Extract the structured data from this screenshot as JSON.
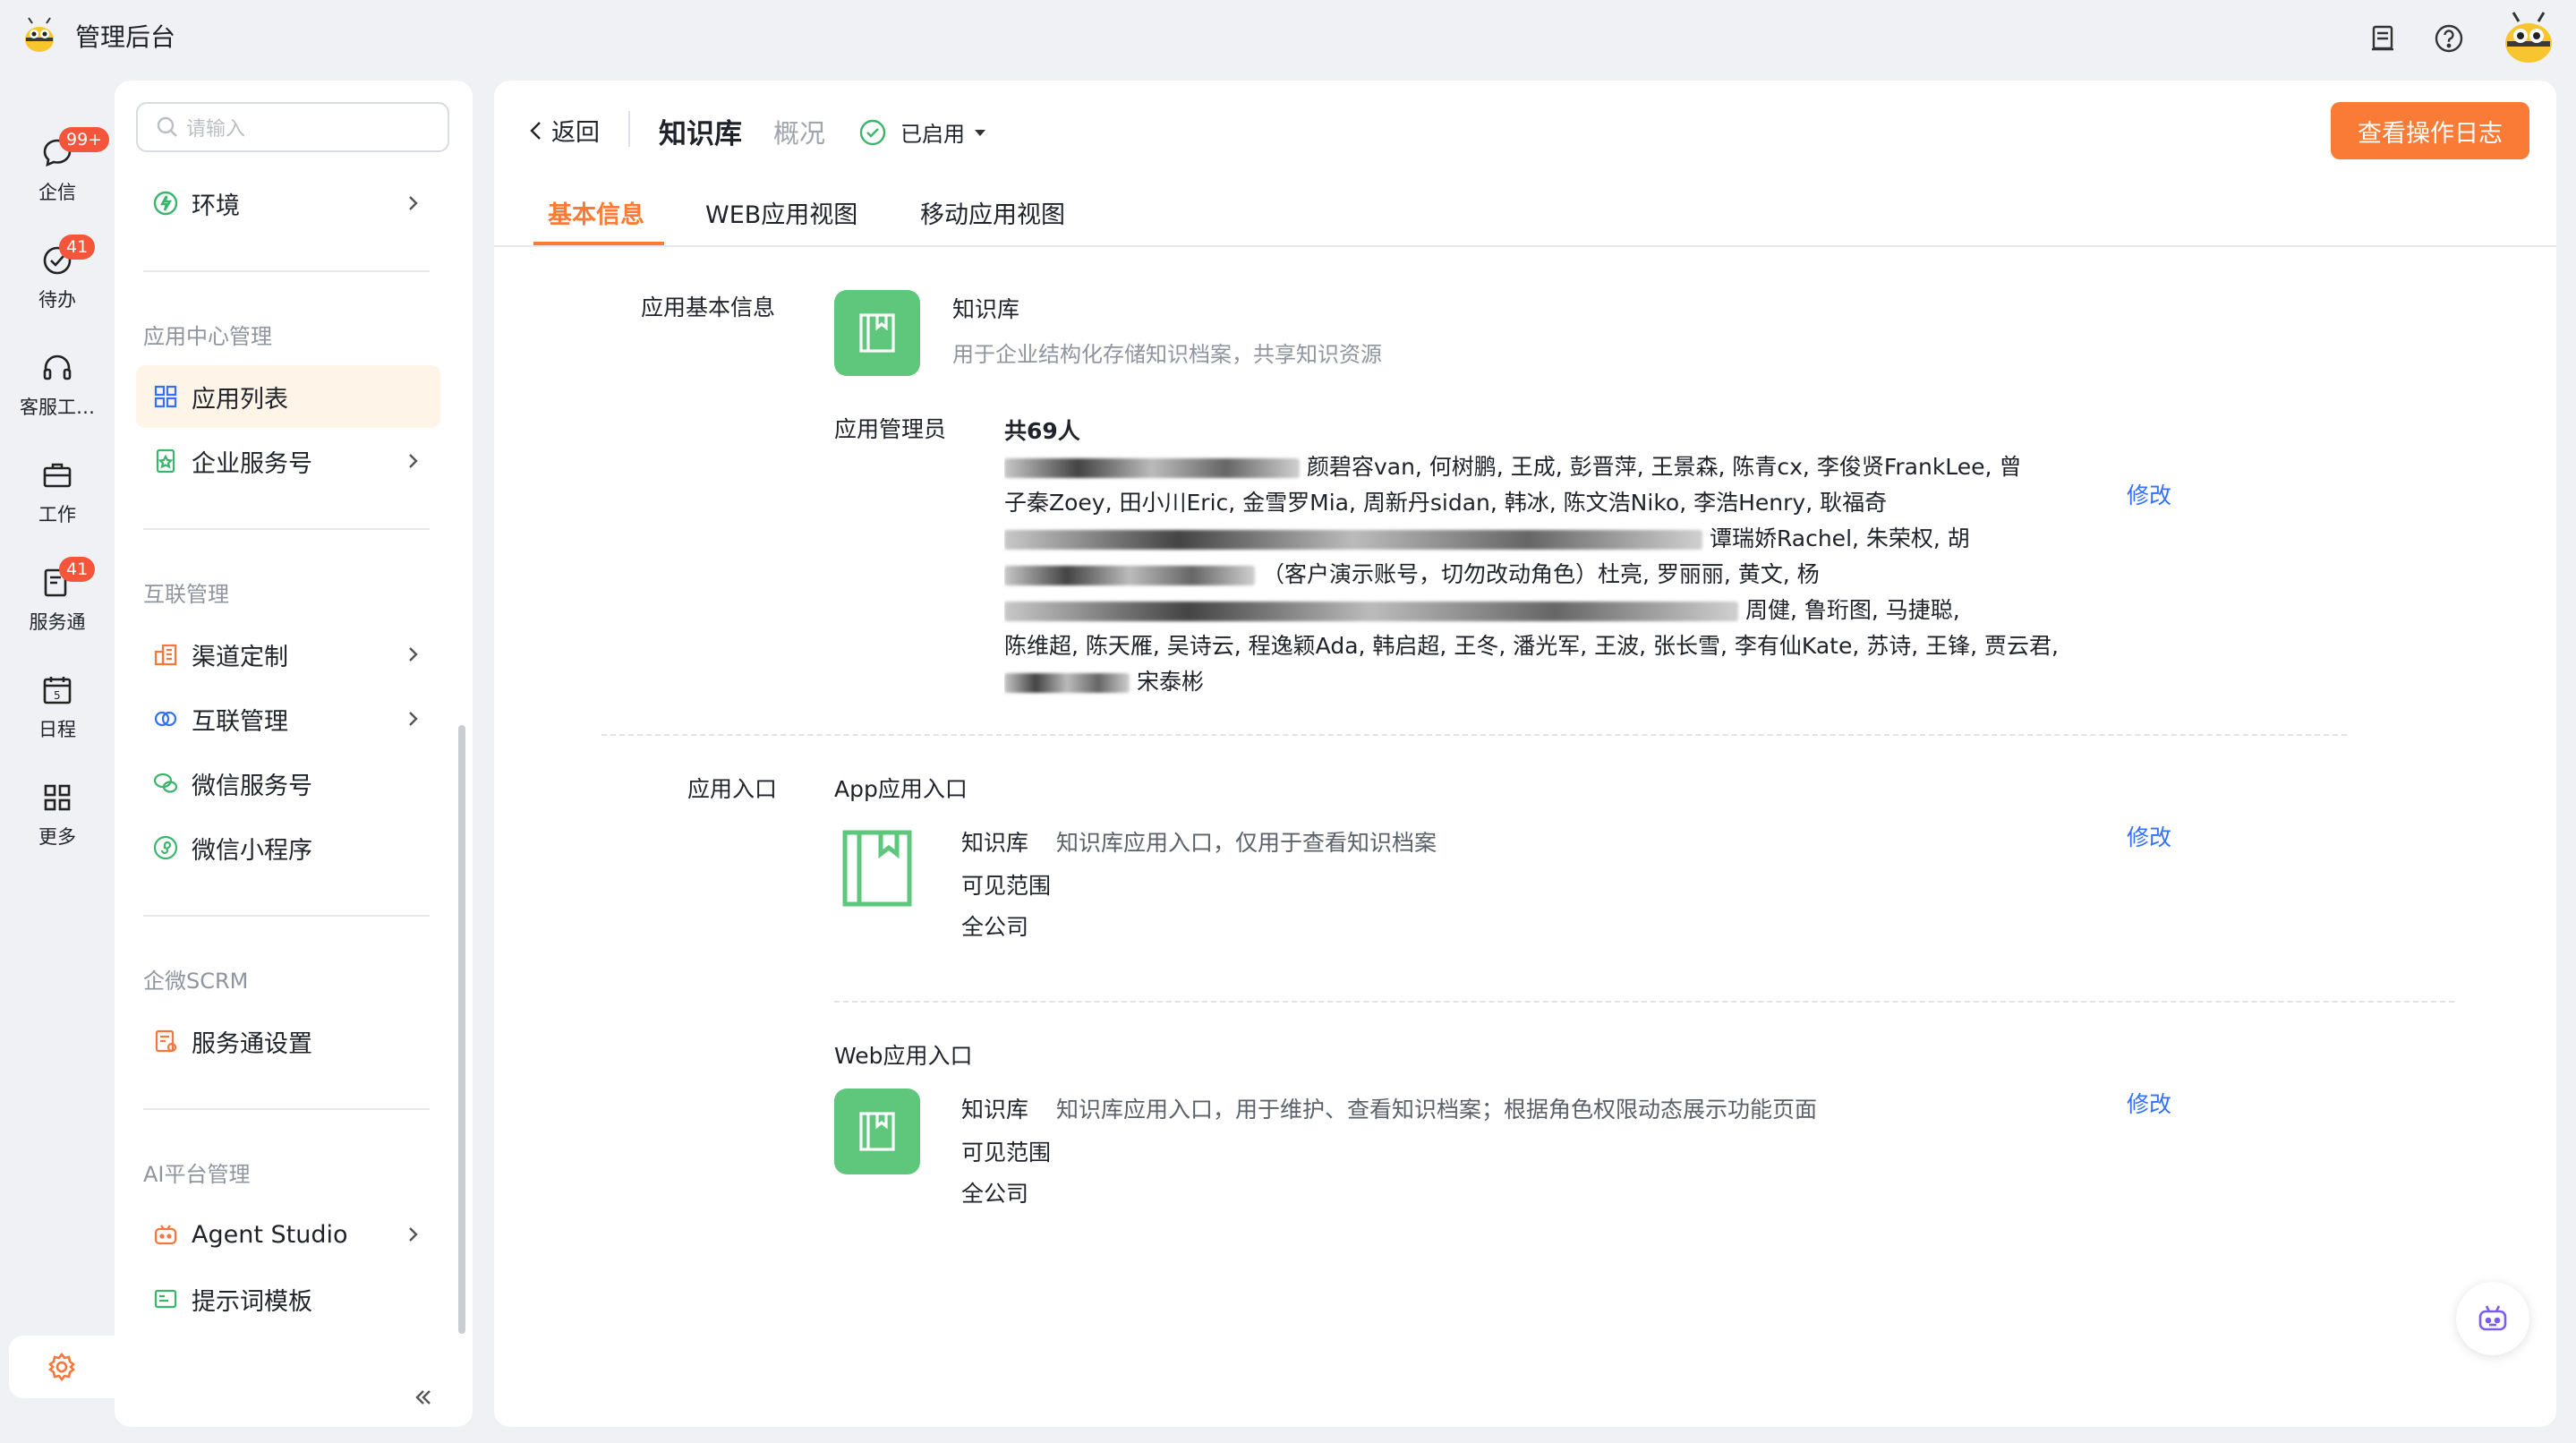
{
  "app": {
    "title": "管理后台"
  },
  "rail": [
    {
      "label": "企信",
      "badge": "99+",
      "icon": "chat-bubble-icon"
    },
    {
      "label": "待办",
      "badge": "41",
      "icon": "check-circle-icon"
    },
    {
      "label": "客服工…",
      "badge": "",
      "icon": "headset-icon"
    },
    {
      "label": "工作",
      "badge": "",
      "icon": "briefcase-icon"
    },
    {
      "label": "服务通",
      "badge": "41",
      "icon": "service-icon"
    },
    {
      "label": "日程",
      "badge": "",
      "icon": "calendar-icon"
    },
    {
      "label": "更多",
      "badge": "",
      "icon": "grid-icon"
    }
  ],
  "nav": {
    "search_placeholder": "请输入",
    "env": "环境",
    "group_app_center": "应用中心管理",
    "app_list": "应用列表",
    "enterprise_service": "企业服务号",
    "group_interconnect": "互联管理",
    "channel_custom": "渠道定制",
    "interconnect_mgmt": "互联管理",
    "wechat_service": "微信服务号",
    "wechat_mini": "微信小程序",
    "group_scrm": "企微SCRM",
    "service_settings": "服务通设置",
    "group_ai": "AI平台管理",
    "agent_studio": "Agent Studio",
    "prompt_template": "提示词模板"
  },
  "header": {
    "back": "返回",
    "title": "知识库",
    "overview": "概况",
    "status": "已启用",
    "log_button": "查看操作日志"
  },
  "tabs": [
    "基本信息",
    "WEB应用视图",
    "移动应用视图"
  ],
  "basic": {
    "section_label": "应用基本信息",
    "app_name": "知识库",
    "app_desc": "用于企业结构化存储知识档案，共享知识资源",
    "admin_label": "应用管理员",
    "admin_count": "共69人",
    "admin_lines": [
      "颜碧容van, 何树鹏, 王成, 彭晋萍, 王景森, 陈青cx, 李俊贤FrankLee, 曾",
      "子秦Zoey, 田小川Eric, 金雪罗Mia, 周新丹sidan, 韩冰, 陈文浩Niko, 李浩Henry, 耿福奇",
      "谭瑞娇Rachel, 朱荣权, 胡",
      "（客户演示账号，切勿改动角色）杜亮, 罗丽丽, 黄文, 杨",
      "周健, 鲁珩图, 马捷聪,",
      "陈维超, 陈天雁, 吴诗云, 程逸颖Ada, 韩启超, 王冬, 潘光军, 王波, 张长雪, 李有仙Kate, 苏诗, 王锋, 贾云君,",
      "宋泰彬"
    ],
    "edit": "修改"
  },
  "entry": {
    "section_label": "应用入口",
    "app_title": "App应用入口",
    "app_name": "知识库",
    "app_desc": "知识库应用入口，仅用于查看知识档案",
    "scope_label": "可见范围",
    "scope_value": "全公司",
    "web_title": "Web应用入口",
    "web_name": "知识库",
    "web_desc": "知识库应用入口，用于维护、查看知识档案；根据角色权限动态展示功能页面",
    "web_scope_label": "可见范围",
    "web_scope_value": "全公司",
    "edit": "修改"
  },
  "colors": {
    "accent": "#f97b36",
    "link": "#3370ff",
    "app_green": "#5fc77b",
    "badge": "#f5553b"
  }
}
